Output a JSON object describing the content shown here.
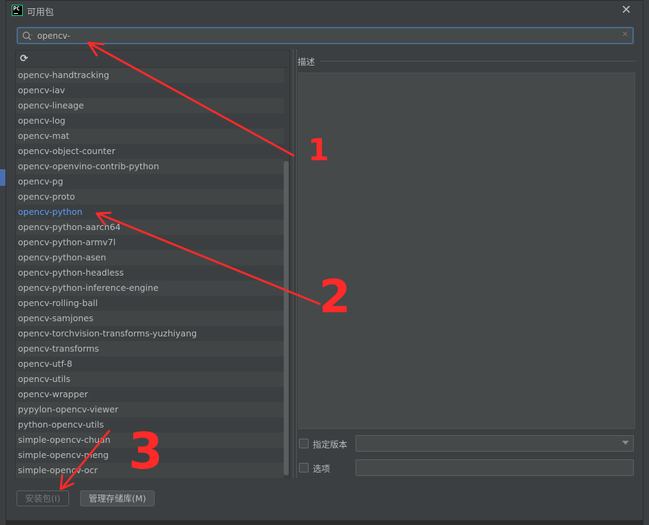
{
  "window": {
    "title": "可用包"
  },
  "search": {
    "value": "opencv-"
  },
  "packages": [
    "opencv-handtracking",
    "opencv-iav",
    "opencv-lineage",
    "opencv-log",
    "opencv-mat",
    "opencv-object-counter",
    "opencv-openvino-contrib-python",
    "opencv-pg",
    "opencv-proto",
    "opencv-python",
    "opencv-python-aarch64",
    "opencv-python-armv7l",
    "opencv-python-asen",
    "opencv-python-headless",
    "opencv-python-inference-engine",
    "opencv-rolling-ball",
    "opencv-samjones",
    "opencv-torchvision-transforms-yuzhiyang",
    "opencv-transforms",
    "opencv-utf-8",
    "opencv-utils",
    "opencv-wrapper",
    "pypylon-opencv-viewer",
    "python-opencv-utils",
    "simple-opencv-chuan",
    "simple-opencv-meng",
    "simple-opencv-ocr"
  ],
  "selected_package": "opencv-python",
  "description": {
    "label": "描述"
  },
  "options": {
    "specify_version_label": "指定版本",
    "options_label": "选项"
  },
  "buttons": {
    "install": "安装包(I)",
    "manage": "管理存储库(M)"
  },
  "annotations": {
    "n1": "1",
    "n2": "2",
    "n3": "3"
  },
  "colors": {
    "accent": "#466d94",
    "selected_text": "#589df6",
    "annotation": "#ff2a2a"
  },
  "icons": {
    "search": "search-icon",
    "refresh": "refresh-icon",
    "close": "close-icon",
    "clear": "clear-icon"
  }
}
